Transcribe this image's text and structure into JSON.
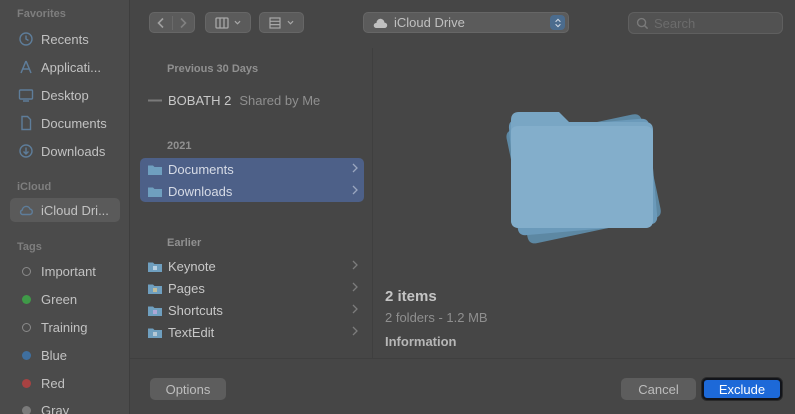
{
  "sidebar": {
    "favorites_header": "Favorites",
    "favorites": [
      {
        "label": "Recents",
        "icon": "clock-icon"
      },
      {
        "label": "Applicati...",
        "icon": "applications-icon"
      },
      {
        "label": "Desktop",
        "icon": "desktop-icon"
      },
      {
        "label": "Documents",
        "icon": "document-icon"
      },
      {
        "label": "Downloads",
        "icon": "download-icon"
      }
    ],
    "icloud_header": "iCloud",
    "icloud_items": [
      {
        "label": "iCloud Dri...",
        "icon": "cloud-icon",
        "selected": true
      }
    ],
    "tags_header": "Tags",
    "tags": [
      {
        "label": "Important",
        "color": "#8a8a8a",
        "hollow": true
      },
      {
        "label": "Green",
        "color": "#3f9a48",
        "hollow": false
      },
      {
        "label": "Training",
        "color": "#8a8a8a",
        "hollow": true
      },
      {
        "label": "Blue",
        "color": "#3f6f9f",
        "hollow": false
      },
      {
        "label": "Red",
        "color": "#a84242",
        "hollow": false
      },
      {
        "label": "Gray",
        "color": "#7a7a7a",
        "hollow": false
      }
    ]
  },
  "toolbar": {
    "location": "iCloud Drive",
    "search_placeholder": "Search"
  },
  "files": {
    "groups": [
      {
        "header": "Previous 30 Days",
        "rows": [
          {
            "name": "BOBATH 2",
            "shared": "Shared by Me",
            "kind": "doc",
            "selected": false,
            "folder": false
          }
        ]
      },
      {
        "header": "2021",
        "rows": [
          {
            "name": "Documents",
            "kind": "folder",
            "selected": true,
            "folder": true
          },
          {
            "name": "Downloads",
            "kind": "folder",
            "selected": true,
            "folder": true
          }
        ]
      },
      {
        "header": "Earlier",
        "rows": [
          {
            "name": "Keynote",
            "kind": "app-folder",
            "selected": false,
            "folder": true
          },
          {
            "name": "Pages",
            "kind": "app-folder",
            "selected": false,
            "folder": true
          },
          {
            "name": "Shortcuts",
            "kind": "app-folder",
            "selected": false,
            "folder": true
          },
          {
            "name": "TextEdit",
            "kind": "app-folder",
            "selected": false,
            "folder": true
          }
        ]
      }
    ]
  },
  "preview": {
    "title": "2 items",
    "subtitle": "2 folders - 1.2 MB",
    "info_header": "Information"
  },
  "buttons": {
    "options": "Options",
    "cancel": "Cancel",
    "exclude": "Exclude"
  },
  "colors": {
    "selection": "#4d6088",
    "accent": "#1d69d8",
    "folder": "#6f9fbf"
  }
}
